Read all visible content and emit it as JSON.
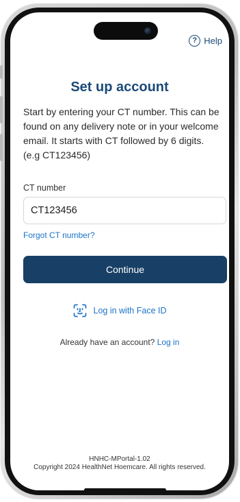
{
  "header": {
    "help_label": "Help",
    "help_icon": "question-circle-icon"
  },
  "main": {
    "title": "Set up account",
    "intro": "Start by entering your CT number. This can be found on any delivery note or in your welcome email. It starts with CT followed by 6 digits. (e.g CT123456)",
    "ct_field": {
      "label": "CT number",
      "value": "CT123456"
    },
    "forgot_link": "Forgot CT number?",
    "continue_label": "Continue",
    "faceid_label": "Log in with Face ID",
    "faceid_icon": "face-id-icon",
    "already_text": "Already have an account?",
    "login_link": "Log in"
  },
  "footer": {
    "version": "HNHC-MPortal-1.02",
    "copyright": "Copyright 2024 HealthNet Hoemcare. All rights reserved."
  },
  "colors": {
    "primary": "#183f66",
    "heading": "#1b4a78",
    "link": "#1a73c9"
  }
}
